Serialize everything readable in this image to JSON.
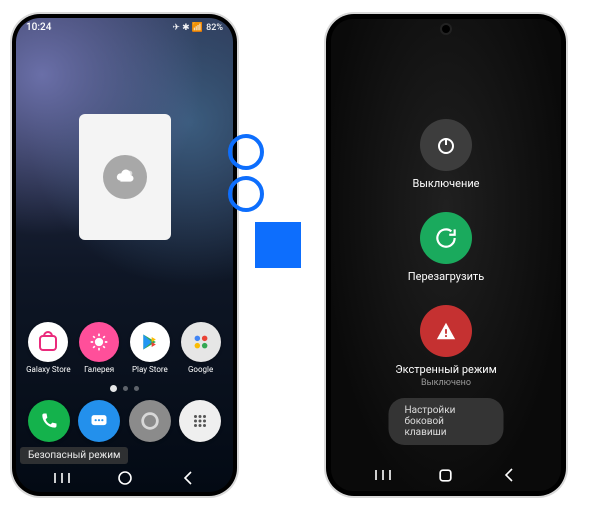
{
  "left": {
    "status": {
      "time": "10:24",
      "battery": "82%",
      "signal_icons": "✈ ✱ 📶"
    },
    "widget": {
      "icon": "weather-cloud-icon"
    },
    "apps": [
      {
        "name": "galaxy-store",
        "label": "Galaxy Store",
        "color": "#fff"
      },
      {
        "name": "gallery",
        "label": "Галерея",
        "color": "#fff"
      },
      {
        "name": "play-store",
        "label": "Play Store",
        "color": "#fff"
      },
      {
        "name": "google-folder",
        "label": "Google",
        "color": "#fff"
      }
    ],
    "dock": [
      {
        "name": "phone",
        "bg": "#14b24c"
      },
      {
        "name": "messages",
        "bg": "#2390ec"
      },
      {
        "name": "assistant",
        "bg": "#7d7d7d"
      },
      {
        "name": "apps",
        "bg": "#e9e9e9"
      }
    ],
    "safe_mode_label": "Безопасный режим",
    "nav": {
      "recent": "|||",
      "home": "○",
      "back": "‹"
    }
  },
  "right": {
    "power_items": [
      {
        "id": "power-off",
        "label": "Выключение",
        "sub": ""
      },
      {
        "id": "restart",
        "label": "Перезагрузить",
        "sub": ""
      },
      {
        "id": "emergency",
        "label": "Экстренный режим",
        "sub": "Выключено"
      }
    ],
    "side_key_label": "Настройки боковой клавиши",
    "nav": {
      "recent": "|||",
      "home": "○",
      "back": "‹"
    }
  }
}
